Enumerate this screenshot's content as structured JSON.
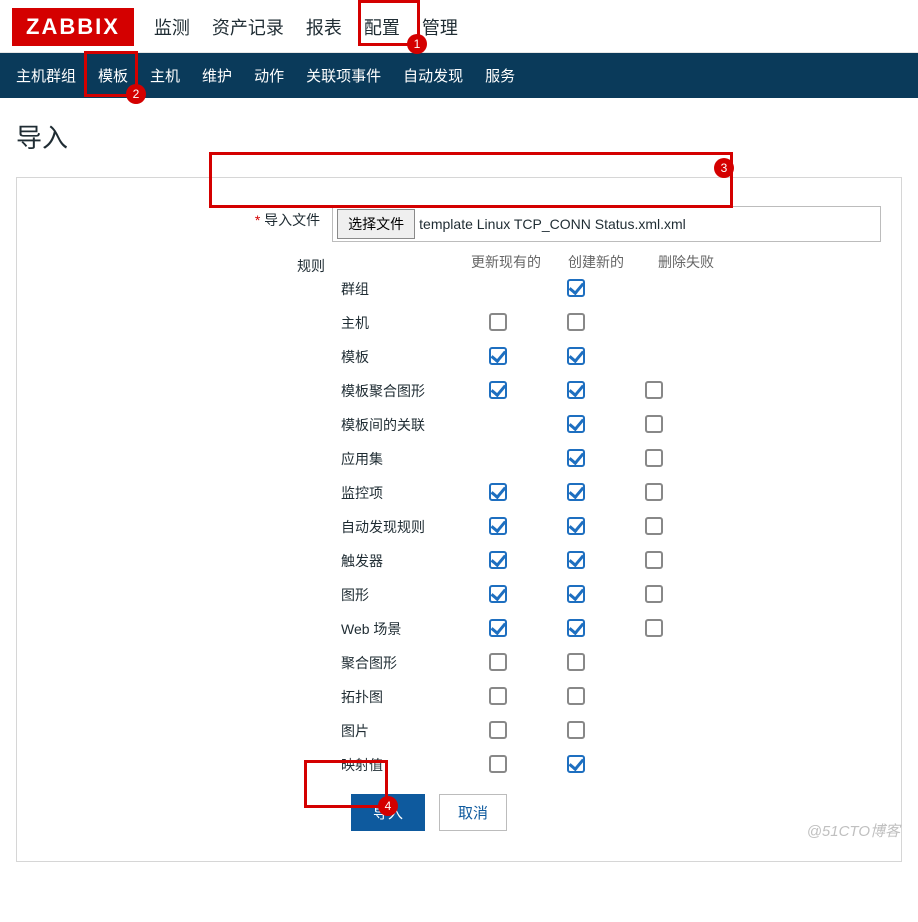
{
  "logo": "ZABBIX",
  "top_menu": [
    "监测",
    "资产记录",
    "报表",
    "配置",
    "管理"
  ],
  "sub_menu": [
    "主机群组",
    "模板",
    "主机",
    "维护",
    "动作",
    "关联项事件",
    "自动发现",
    "服务"
  ],
  "page_title": "导入",
  "file_label": "导入文件",
  "file_button": "选择文件",
  "file_name": "template Linux TCP_CONN Status.xml.xml",
  "rules_label": "规则",
  "rules_headers": [
    "更新现有的",
    "创建新的",
    "删除失败"
  ],
  "rules": [
    {
      "label": "群组",
      "cols": [
        null,
        true,
        null
      ]
    },
    {
      "label": "主机",
      "cols": [
        false,
        false,
        null
      ]
    },
    {
      "label": "模板",
      "cols": [
        true,
        true,
        null
      ]
    },
    {
      "label": "模板聚合图形",
      "cols": [
        true,
        true,
        false
      ]
    },
    {
      "label": "模板间的关联",
      "cols": [
        null,
        true,
        false
      ]
    },
    {
      "label": "应用集",
      "cols": [
        null,
        true,
        false
      ]
    },
    {
      "label": "监控项",
      "cols": [
        true,
        true,
        false
      ]
    },
    {
      "label": "自动发现规则",
      "cols": [
        true,
        true,
        false
      ]
    },
    {
      "label": "触发器",
      "cols": [
        true,
        true,
        false
      ]
    },
    {
      "label": "图形",
      "cols": [
        true,
        true,
        false
      ]
    },
    {
      "label": "Web 场景",
      "cols": [
        true,
        true,
        false
      ]
    },
    {
      "label": "聚合图形",
      "cols": [
        false,
        false,
        null
      ]
    },
    {
      "label": "拓扑图",
      "cols": [
        false,
        false,
        null
      ]
    },
    {
      "label": "图片",
      "cols": [
        false,
        false,
        null
      ]
    },
    {
      "label": "映射值",
      "cols": [
        false,
        true,
        null
      ]
    }
  ],
  "import_btn": "导入",
  "cancel_btn": "取消",
  "annotations": {
    "a1": "1",
    "a2": "2",
    "a3": "3",
    "a4": "4"
  },
  "watermark": "@51CTO博客"
}
